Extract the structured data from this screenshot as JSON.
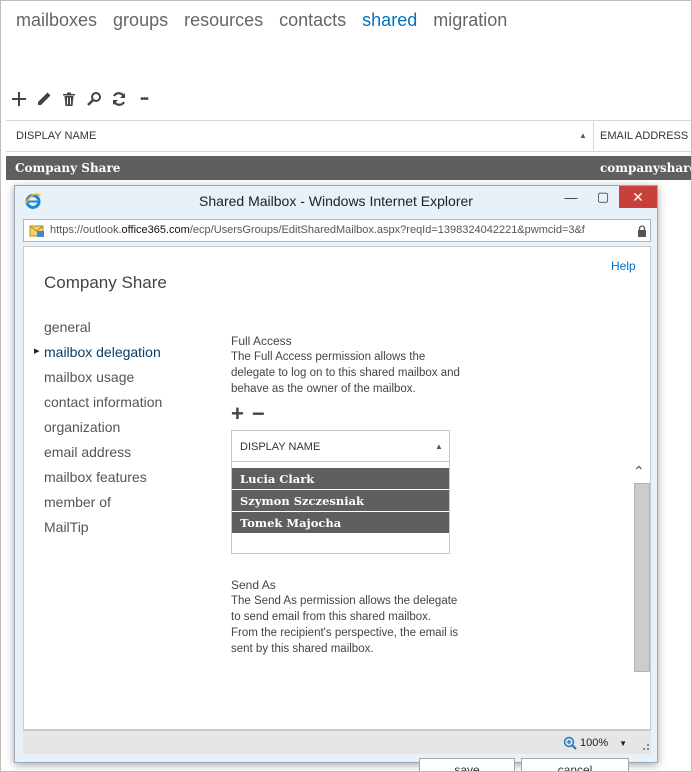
{
  "topnav": {
    "items": [
      "mailboxes",
      "groups",
      "resources",
      "contacts",
      "shared",
      "migration"
    ],
    "active": "shared"
  },
  "toolbar": {
    "icons": [
      "add-icon",
      "edit-icon",
      "delete-icon",
      "search-icon",
      "refresh-icon",
      "more-icon"
    ],
    "add": "+",
    "more": "•••"
  },
  "grid": {
    "columns": [
      "DISPLAY NAME",
      "EMAIL ADDRESS"
    ],
    "rows": [
      {
        "display_name": "Company Share",
        "email": "companyshare@"
      }
    ]
  },
  "window": {
    "title": "Shared Mailbox - Windows Internet Explorer",
    "address_prefix": "https://outlook.",
    "address_domain": "office365.com",
    "address_rest": "/ecp/UsersGroups/EditSharedMailbox.aspx?reqId=1398324042221&pwmcid=3&f",
    "close": "✕",
    "minimize": "—",
    "maximize": "▢"
  },
  "dialog": {
    "help": "Help",
    "heading": "Company Share",
    "nav": [
      "general",
      "mailbox delegation",
      "mailbox usage",
      "contact information",
      "organization",
      "email address",
      "mailbox features",
      "member of",
      "MailTip"
    ],
    "active_nav": "mailbox delegation",
    "full_access": {
      "title": "Full Access",
      "description": "The Full Access permission allows the delegate to log on to this shared mailbox and behave as the owner of the mailbox.",
      "add": "+",
      "remove": "−",
      "column": "DISPLAY NAME",
      "members": [
        "Lucia Clark",
        "Szymon Szczesniak",
        "Tomek Majocha"
      ]
    },
    "send_as": {
      "title": "Send As",
      "description": "The Send As permission allows the delegate to send email from this shared mailbox. From the recipient's perspective, the email is sent by this shared mailbox."
    },
    "save_label": "save",
    "cancel_label": "cancel"
  },
  "statusbar": {
    "zoom": "100%"
  },
  "colors": {
    "accent": "#0072c6",
    "selected_row": "#5f5f5f",
    "close_button": "#c7403a"
  }
}
